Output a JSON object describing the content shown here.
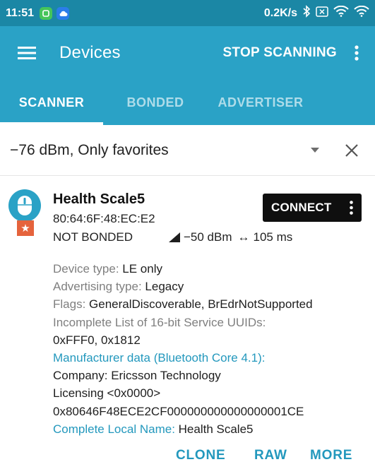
{
  "status_bar": {
    "time": "11:51",
    "speed": "0.2K/s",
    "icons": [
      "app-notification-icon",
      "cloud-icon",
      "bluetooth-icon",
      "sim-icon",
      "wifi-icon",
      "wifi-icon"
    ]
  },
  "app_bar": {
    "title": "Devices",
    "action": "STOP SCANNING",
    "color": "#2aa2c6"
  },
  "tabs": [
    {
      "label": "SCANNER",
      "active": true
    },
    {
      "label": "BONDED",
      "active": false
    },
    {
      "label": "ADVERTISER",
      "active": false
    }
  ],
  "filter": {
    "text": "−76 dBm, Only favorites"
  },
  "device": {
    "name": "Health Scale5",
    "address": "80:64:6F:48:EC:E2",
    "bond_state": "NOT BONDED",
    "rssi": "−50 dBm",
    "interval": "105 ms",
    "connect_label": "CONNECT",
    "details": {
      "device_type_label": "Device type: ",
      "device_type_value": "LE only",
      "adv_type_label": "Advertising type: ",
      "adv_type_value": "Legacy",
      "flags_label": "Flags: ",
      "flags_value": "GeneralDiscoverable, BrEdrNotSupported",
      "uuids_label": "Incomplete List of 16-bit Service UUIDs:",
      "uuids_value": "0xFFF0, 0x1812",
      "manufacturer_label": "Manufacturer data (Bluetooth Core 4.1):",
      "company": "Company: Ericsson Technology",
      "licensing": "Licensing <0x0000>",
      "raw_data": "0x80646F48ECE2CF000000000000000001CE",
      "local_name_label": "Complete Local Name: ",
      "local_name_value": "Health Scale5"
    },
    "actions": {
      "clone": "CLONE",
      "raw": "RAW",
      "more": "MORE"
    }
  },
  "colors": {
    "status_bar": "#1b87a5",
    "accent": "#2aa2c6",
    "link": "#2398bd",
    "favorite_badge": "#e5633c"
  }
}
